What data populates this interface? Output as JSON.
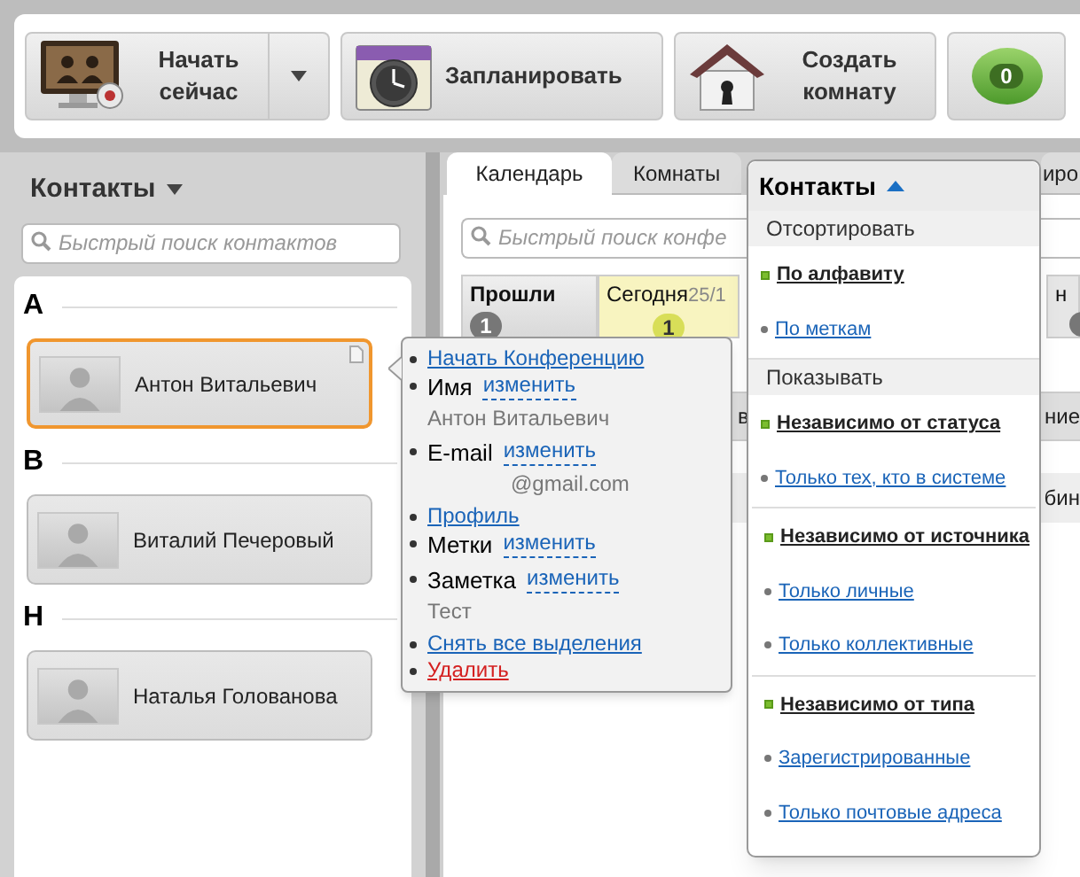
{
  "toolbar": {
    "buttons": [
      {
        "kind": "start",
        "label": "Начать сейчас",
        "has_menu": true
      },
      {
        "kind": "schedule",
        "label": "Запланировать"
      },
      {
        "kind": "room",
        "label": "Создать комнату"
      },
      {
        "kind": "messages",
        "label": "0"
      }
    ]
  },
  "contacts_panel": {
    "title": "Контакты",
    "search": {
      "placeholder": "Быстрый поиск контактов"
    },
    "groups": [
      {
        "letter": "А",
        "contacts": [
          {
            "name": "Антон Витальевич",
            "selected": true
          }
        ]
      },
      {
        "letter": "В",
        "contacts": [
          {
            "name": "Виталий Печеровый",
            "selected": false
          }
        ]
      },
      {
        "letter": "Н",
        "contacts": [
          {
            "name": "Наталья Голованова",
            "selected": false
          }
        ]
      }
    ]
  },
  "main": {
    "tabs": [
      {
        "label": "Календарь",
        "selected": true
      },
      {
        "label": "Комнаты",
        "selected": false
      },
      {
        "label": "иро",
        "selected": false
      }
    ],
    "search": {
      "placeholder": "Быстрый поиск конфе"
    },
    "columns": [
      {
        "kind": "past",
        "label": "Прошли",
        "count": "1"
      },
      {
        "kind": "today",
        "label": "Сегодня",
        "date": "25/1",
        "count": "1"
      },
      {
        "kind": "future",
        "label": "н"
      }
    ],
    "rows": [
      {
        "kind": "header",
        "left": "в",
        "right": "ние"
      },
      {
        "kind": "item",
        "right": "бин"
      }
    ]
  },
  "contact_menu": {
    "items": [
      {
        "kind": "link",
        "text": "Начать Конференцию"
      },
      {
        "kind": "field",
        "label": "Имя",
        "action": "изменить",
        "value": "Антон Витальевич"
      },
      {
        "kind": "field",
        "label": "E-mail",
        "action": "изменить",
        "value": "@gmail.com"
      },
      {
        "kind": "link",
        "text": "Профиль"
      },
      {
        "kind": "field",
        "label": "Метки",
        "action": "изменить"
      },
      {
        "kind": "field",
        "label": "Заметка",
        "action": "изменить",
        "value": "Тест"
      },
      {
        "kind": "link",
        "text": "Снять все выделения"
      },
      {
        "kind": "danger",
        "text": "Удалить"
      }
    ]
  },
  "filter_menu": {
    "title": "Контакты",
    "expanded": true,
    "sections": [
      {
        "heading": "Отсортировать",
        "groups": [
          [
            {
              "label": "По алфавиту",
              "selected": true
            },
            {
              "label": "По меткам",
              "selected": false
            }
          ]
        ]
      },
      {
        "heading": "Показывать",
        "groups": [
          [
            {
              "label": "Независимо от статуса",
              "selected": true
            },
            {
              "label": "Только тех, кто в системе",
              "selected": false
            }
          ],
          [
            {
              "label": "Независимо от источника",
              "selected": true
            },
            {
              "label": "Только личные",
              "selected": false
            },
            {
              "label": "Только коллективные",
              "selected": false
            }
          ],
          [
            {
              "label": "Независимо от типа",
              "selected": true
            },
            {
              "label": "Зарегистрированные",
              "selected": false
            },
            {
              "label": "Только почтовые адреса",
              "selected": false
            }
          ]
        ]
      }
    ]
  }
}
